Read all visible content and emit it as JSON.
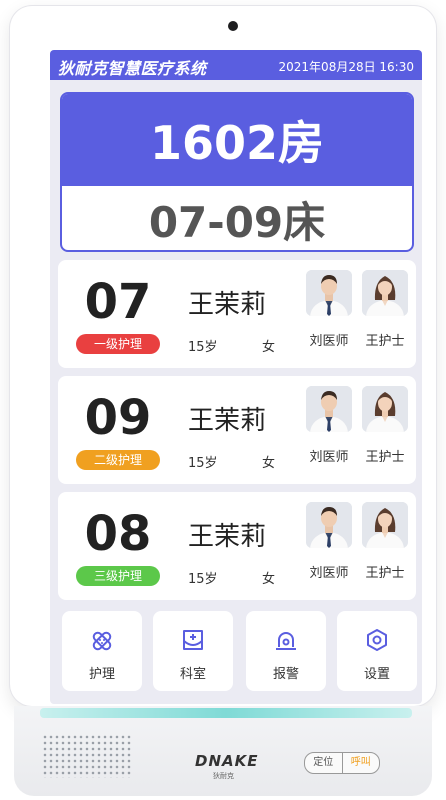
{
  "header": {
    "app_title": "狄耐克智慧医疗系统",
    "datetime": "2021年08月28日 16:30"
  },
  "room": {
    "room_label": "1602房",
    "bed_range": "07-09床"
  },
  "patients": [
    {
      "bed": "07",
      "care_level": "一级护理",
      "care_color": "#e94040",
      "name": "王茉莉",
      "age": "15岁",
      "sex": "女",
      "doctor": "刘医师",
      "nurse": "王护士"
    },
    {
      "bed": "09",
      "care_level": "二级护理",
      "care_color": "#f0a020",
      "name": "王茉莉",
      "age": "15岁",
      "sex": "女",
      "doctor": "刘医师",
      "nurse": "王护士"
    },
    {
      "bed": "08",
      "care_level": "三级护理",
      "care_color": "#5cc84a",
      "name": "王茉莉",
      "age": "15岁",
      "sex": "女",
      "doctor": "刘医师",
      "nurse": "王护士"
    }
  ],
  "nav": {
    "items": [
      {
        "label": "护理",
        "icon": "nursing-icon"
      },
      {
        "label": "科室",
        "icon": "department-icon"
      },
      {
        "label": "报警",
        "icon": "alarm-icon"
      },
      {
        "label": "设置",
        "icon": "settings-icon"
      }
    ]
  },
  "device": {
    "brand": "DNAKE",
    "brand_sub": "狄耐克",
    "locate_label": "定位",
    "call_label": "呼叫"
  },
  "colors": {
    "accent": "#5a5ee0",
    "icon": "#5a5ee0",
    "call": "#f0a020"
  }
}
